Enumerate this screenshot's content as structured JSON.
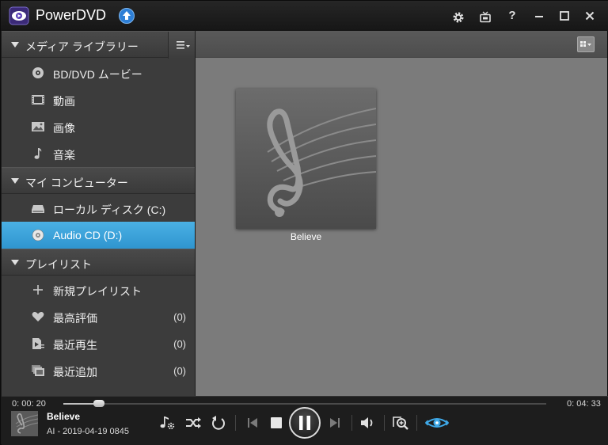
{
  "app": {
    "title": "PowerDVD"
  },
  "titlebar_icons": [
    "gear-icon",
    "tv-icon",
    "help-icon",
    "minimize-icon",
    "maximize-icon",
    "close-icon"
  ],
  "sidebar": {
    "sections": [
      {
        "label": "メディア ライブラリー",
        "items": [
          {
            "label": "BD/DVD ムービー",
            "icon": "disc-icon"
          },
          {
            "label": "動画",
            "icon": "film-icon"
          },
          {
            "label": "画像",
            "icon": "image-icon"
          },
          {
            "label": "音楽",
            "icon": "music-note-icon"
          }
        ]
      },
      {
        "label": "マイ コンピューター",
        "items": [
          {
            "label": "ローカル ディスク (C:)",
            "icon": "drive-icon"
          },
          {
            "label": "Audio CD (D:)",
            "icon": "cd-icon",
            "selected": true
          }
        ]
      },
      {
        "label": "プレイリスト",
        "items": [
          {
            "label": "新規プレイリスト",
            "icon": "plus-icon"
          },
          {
            "label": "最高評価",
            "count": "(0)",
            "icon": "heart-icon"
          },
          {
            "label": "最近再生",
            "count": "(0)",
            "icon": "recent-played-icon"
          },
          {
            "label": "最近追加",
            "count": "(0)",
            "icon": "recent-added-icon"
          }
        ]
      }
    ]
  },
  "content": {
    "albums": [
      {
        "title": "Believe"
      }
    ]
  },
  "player": {
    "elapsed": "0: 00: 20",
    "total": "0: 04: 33",
    "progress_fraction": 0.073,
    "now_playing": {
      "title": "Believe",
      "subtitle": "AI - 2019-04-19 0845"
    }
  },
  "colors": {
    "accent": "#35a0d8",
    "sidebar_bg": "#3c3c3c",
    "content_bg": "#7b7b7b",
    "upgrade_badge": "#2e7fd6"
  }
}
